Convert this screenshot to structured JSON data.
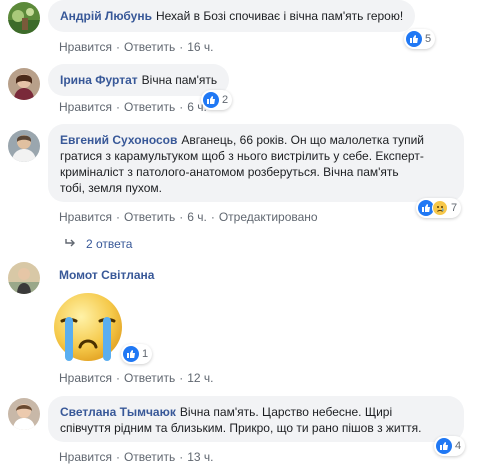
{
  "comments": [
    {
      "author": "Андрій Любунь",
      "text": "Нехай в Бозі спочиває і вічна пам'ять герою!",
      "actions": {
        "like": "Нравится",
        "reply": "Ответить",
        "time": "16 ч."
      },
      "reactions": {
        "count": "5"
      }
    },
    {
      "author": "Ірина Фуртат",
      "text": "Вічна пам'ять",
      "actions": {
        "like": "Нравится",
        "reply": "Ответить",
        "time": "6 ч."
      },
      "reactions": {
        "count": "2"
      }
    },
    {
      "author": "Евгений Сухоносов",
      "text_lines": [
        "Авганець, 66 років. Он що малолетка тупий",
        "гратися з карамультуком щоб з нього вистрілить у себе. Експерт-",
        "криміналіст з патолого-анатомом розберуться. Вічна пам'ять",
        "тобі, земля пухом."
      ],
      "actions": {
        "like": "Нравится",
        "reply": "Ответить",
        "time": "6 ч.",
        "edited": "Отредактировано"
      },
      "reactions": {
        "count": "7"
      },
      "replies_label": "2 ответа"
    },
    {
      "author": "Момот Світлана",
      "sticker": "crying-face-sticker",
      "actions": {
        "like": "Нравится",
        "reply": "Ответить",
        "time": "12 ч."
      },
      "reactions": {
        "count": "1"
      }
    },
    {
      "author": "Светлана Тымчаюк",
      "text_lines": [
        "Вічна пам'ять. Царство небесне. Щирі",
        "співчуття рідним та близьким. Прикро, що ти рано пішов з життя."
      ],
      "actions": {
        "like": "Нравится",
        "reply": "Ответить",
        "time": "13 ч."
      },
      "reactions": {
        "count": "4"
      }
    }
  ],
  "colors": {
    "author": "#385898",
    "bubble": "#f2f3f5",
    "meta": "#606770",
    "like": "#2078f4",
    "sad": "#f7c84b"
  }
}
